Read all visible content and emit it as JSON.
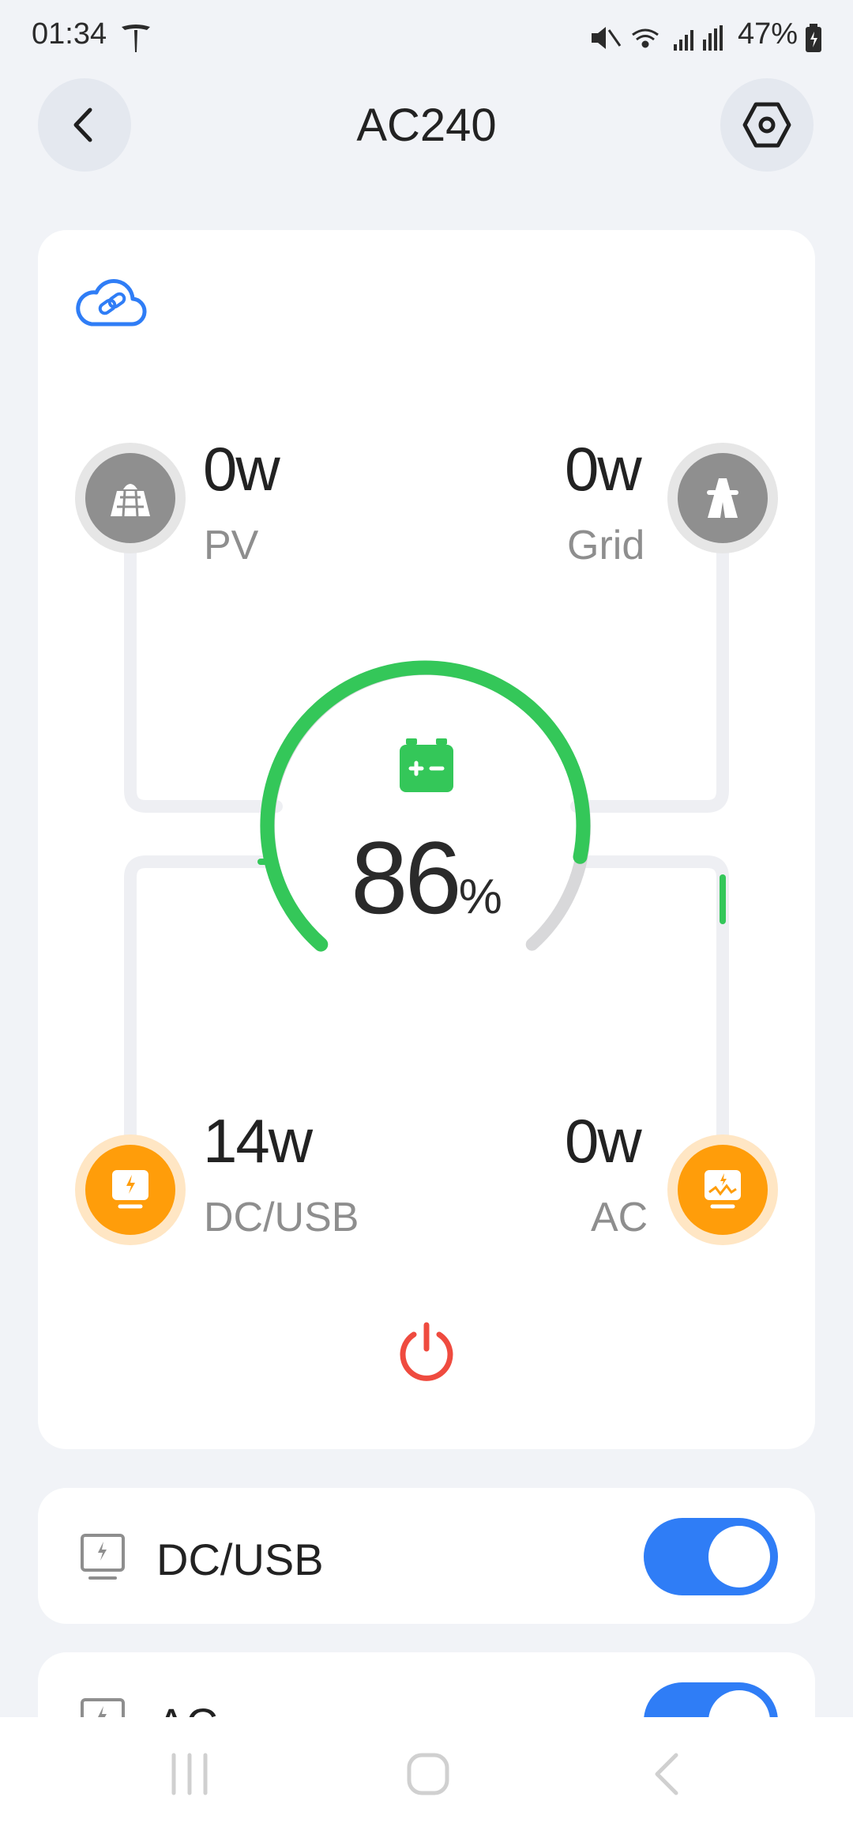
{
  "status_bar": {
    "time": "01:34",
    "battery": "47%"
  },
  "header": {
    "title": "AC240"
  },
  "flow": {
    "pv": {
      "value": "0w",
      "label": "PV"
    },
    "grid": {
      "value": "0w",
      "label": "Grid"
    },
    "dc_usb": {
      "value": "14w",
      "label": "DC/USB"
    },
    "ac": {
      "value": "0w",
      "label": "AC"
    },
    "battery": {
      "number": "86",
      "unit": "%",
      "level": 0.86
    }
  },
  "outputs": {
    "dc_usb": {
      "label": "DC/USB",
      "enabled": true
    },
    "ac": {
      "label": "AC",
      "enabled": true
    }
  },
  "colors": {
    "accent": "#2f7df6",
    "battery_green": "#34c759",
    "output_orange": "#ff9d0a",
    "inactive_gray": "#8f8f8f",
    "power_red": "#ef4b3f"
  },
  "icons": {
    "back": "chevron-left-icon",
    "settings": "hex-nut-icon",
    "cloud": "cloud-link-icon",
    "pv": "solar-panel-icon",
    "grid": "power-tower-icon",
    "dc_usb": "dc-output-icon",
    "ac": "ac-output-icon",
    "battery": "battery-icon",
    "power": "power-icon"
  }
}
